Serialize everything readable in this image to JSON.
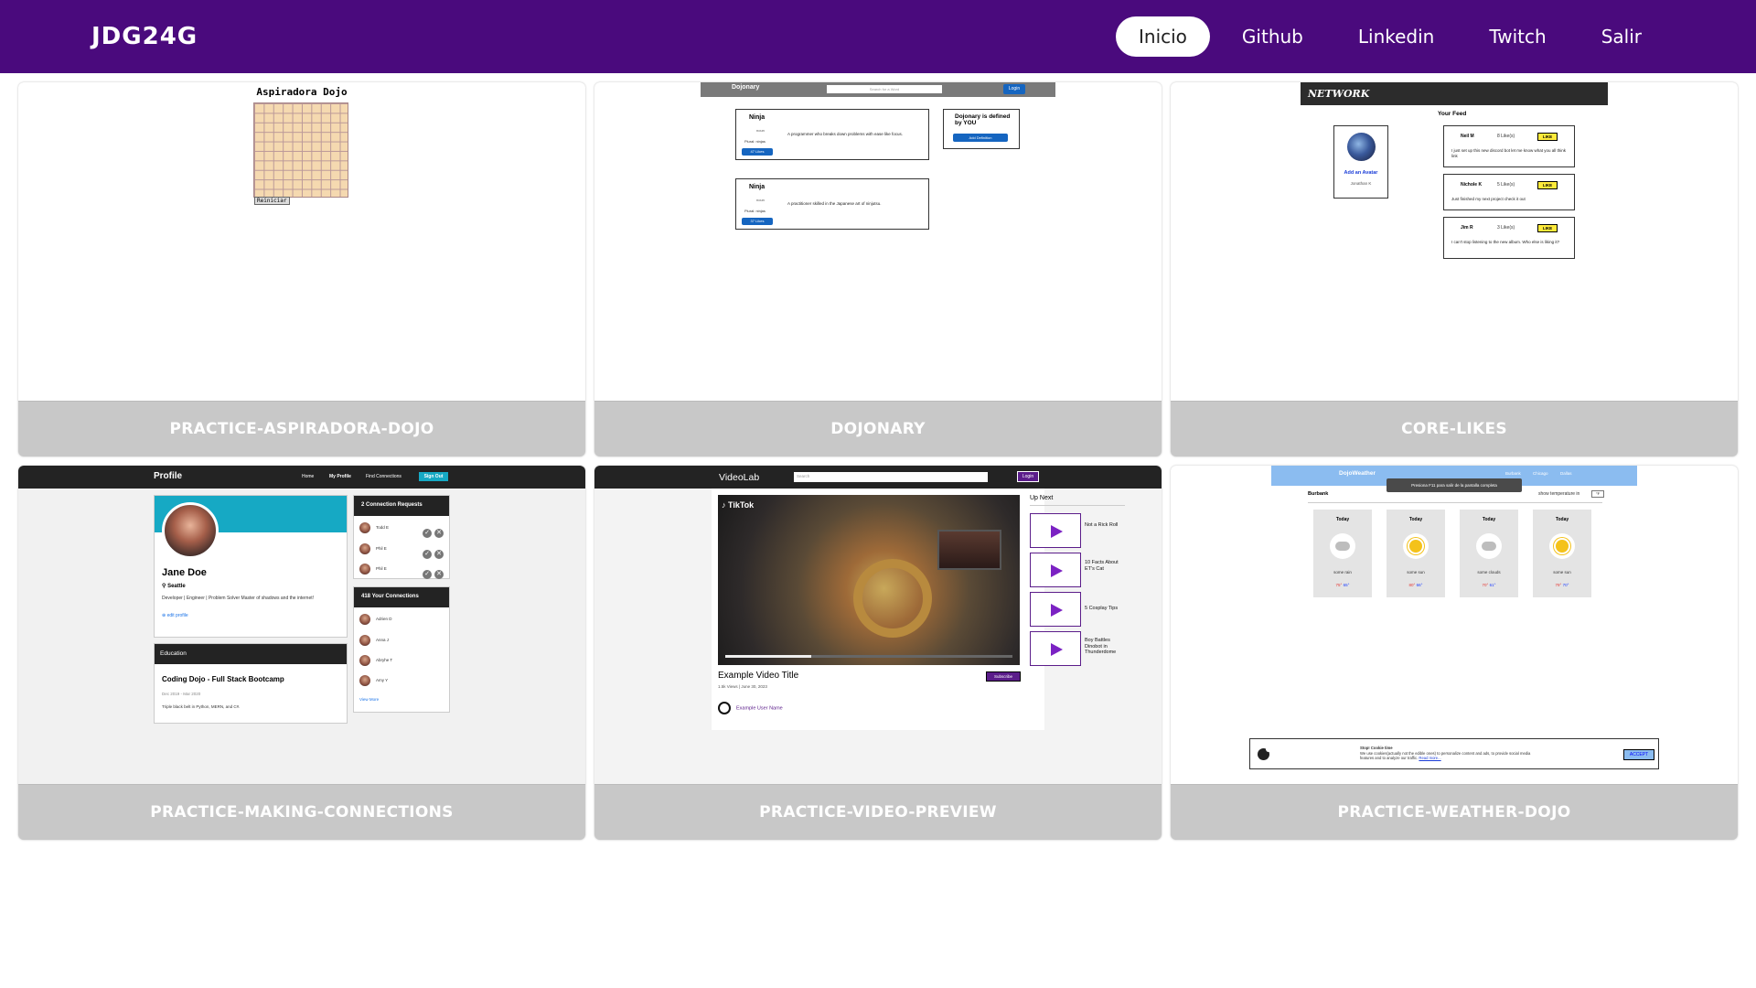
{
  "navbar": {
    "brand": "JDG24G",
    "links": [
      {
        "label": "Inicio",
        "active": true
      },
      {
        "label": "Github"
      },
      {
        "label": "Linkedin"
      },
      {
        "label": "Twitch"
      },
      {
        "label": "Salir"
      }
    ]
  },
  "cards": [
    {
      "label": "PRACTICE-ASPIRADORA-DOJO",
      "preview": {
        "title": "Aspiradora Dojo",
        "button": "Reiniciar"
      }
    },
    {
      "label": "DOJONARY",
      "preview": {
        "brand": "Dojonary",
        "search_placeholder": "Search for a Word",
        "login": "Login",
        "entries": [
          {
            "word": "Ninja",
            "pos": "noun",
            "plural": "Plural: ninjas",
            "likes": "47 Likes",
            "definition": "A programmer who breaks down problems with ease like focus."
          },
          {
            "word": "Ninja",
            "pos": "noun",
            "plural": "Plural: ninjas",
            "likes": "37 Likes",
            "definition": "A practitioner skilled in the Japanese art of ninjutsu."
          }
        ],
        "side_text": "Dojonary is defined by YOU",
        "side_button": "Add Definition"
      }
    },
    {
      "label": "CORE-LIKES",
      "preview": {
        "logo": "NETWORK",
        "feed_title": "Your Feed",
        "profile_link": "Add an Avatar",
        "profile_name": "Jonathan K",
        "posts": [
          {
            "name": "Neil M",
            "likes": "8 Like(s)",
            "button": "LIKE",
            "text": "I just set up this new discord bot let me know what you all think link"
          },
          {
            "name": "Nichole K",
            "likes": "5 Like(s)",
            "button": "LIKE",
            "text": "Just finished my next project check it out"
          },
          {
            "name": "Jim R",
            "likes": "3 Like(s)",
            "button": "LIKE",
            "text": "I can't stop listening to the new album. Who else is liking it?"
          }
        ]
      }
    },
    {
      "label": "PRACTICE-MAKING-CONNECTIONS",
      "preview": {
        "title": "Profile",
        "nav": [
          "Home",
          "My Profile",
          "Find Connections"
        ],
        "signout": "Sign Out",
        "name": "Jane Doe",
        "location": "Seattle",
        "bio": "Developer | Engineer | Problem Solver Master of shadows and the internet!",
        "edit": "edit profile",
        "education_head": "Education",
        "school": "Coding Dojo - Full Stack Bootcamp",
        "dates": "Dec 2019 - Mar 2020",
        "edu_desc": "Triple black belt in Python, MERN, and C#.",
        "requests_head": "Connection Requests",
        "requests_count": "2",
        "requests": [
          "Todd E",
          "Phil E",
          "Phil E"
        ],
        "connections_head": "Your Connections",
        "connections_count": "418",
        "connections": [
          "Adrien D",
          "Anna J",
          "Abryhe T",
          "Amy Y"
        ],
        "view_more": "View More"
      }
    },
    {
      "label": "PRACTICE-VIDEO-PREVIEW",
      "preview": {
        "brand": "VideoLab",
        "search_placeholder": "Search",
        "login": "Login",
        "tiktok": "TikTok",
        "video_title": "Example Video Title",
        "meta": "1.5k Views | June 30, 2023",
        "subscribe": "Subscribe",
        "user": "Example User Name",
        "up_next_title": "Up Next",
        "up_next": [
          "Not a Rick Roll",
          "10 Facts About ET's Cat",
          "5 Cosplay Tips",
          "Boy Battles Dinobot in Thunderdome"
        ]
      }
    },
    {
      "label": "PRACTICE-WEATHER-DOJO",
      "preview": {
        "brand": "DojoWeather",
        "nav": [
          "Burbank",
          "Chicago",
          "Dallas"
        ],
        "toast": "Presiona F11 para salir de la pantalla completa",
        "city": "Burbank",
        "temp_label": "show temperature in",
        "temp_unit": "°F",
        "days": [
          {
            "day": "Today",
            "desc": "some rain",
            "hi": "75°",
            "lo": "65°",
            "icon": "rain-cloud-icon"
          },
          {
            "day": "Today",
            "desc": "some sun",
            "hi": "80°",
            "lo": "66°",
            "icon": "sun-icon"
          },
          {
            "day": "Today",
            "desc": "some clouds",
            "hi": "70°",
            "lo": "61°",
            "icon": "cloud-icon"
          },
          {
            "day": "Today",
            "desc": "some sun",
            "hi": "79°",
            "lo": "70°",
            "icon": "sun-icon"
          }
        ],
        "cookie_title": "Stop! Cookie time",
        "cookie_text": "We use cookies(actually not the edible ones) to personalize content and ads, to provide social media features and to analyze our traffic.",
        "cookie_link": "Read more...",
        "accept": "ACCEPT"
      }
    }
  ]
}
